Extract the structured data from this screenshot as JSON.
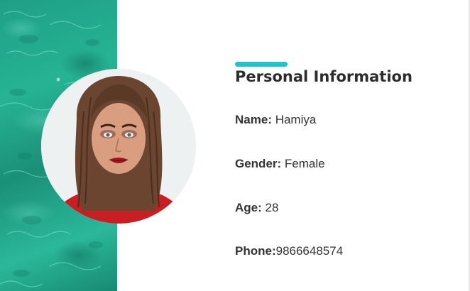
{
  "card": {
    "title": "Personal Information",
    "accent_color": "#1fc3cc",
    "image_icon": "profile-photo",
    "fields": [
      {
        "label": "Name:",
        "value": " Hamiya"
      },
      {
        "label": "Gender:",
        "value": " Female"
      },
      {
        "label": "Age:",
        "value": " 28"
      },
      {
        "label": "Phone:",
        "value": "9866648574"
      }
    ]
  }
}
